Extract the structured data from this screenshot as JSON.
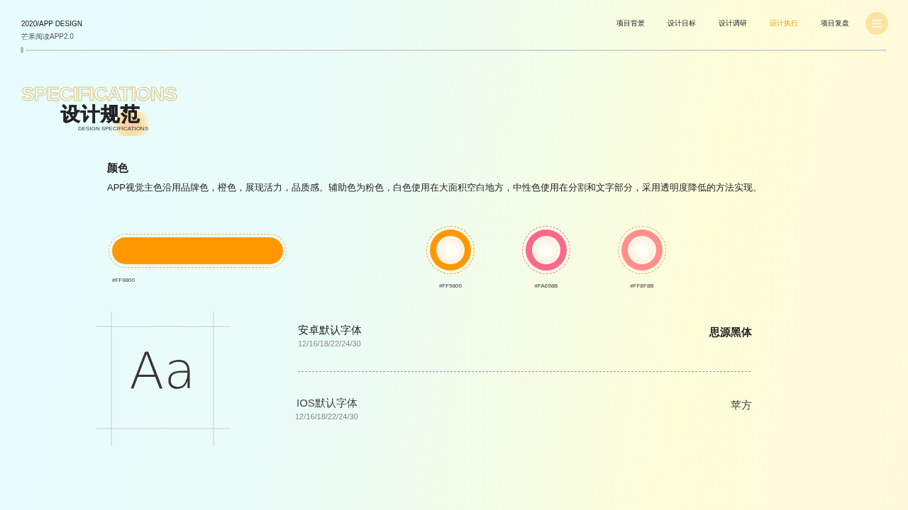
{
  "header": {
    "title": "2020/APP DESIGN",
    "subtitle": "芒果阅读APP2.0"
  },
  "nav": [
    {
      "label": "项目背景",
      "selected": false
    },
    {
      "label": "设计目标",
      "selected": false
    },
    {
      "label": "设计调研",
      "selected": false
    },
    {
      "label": "设计执行",
      "selected": true
    },
    {
      "label": "项目复盘",
      "selected": false
    }
  ],
  "section_heading": {
    "outline_text": "SPECIFICATIONS",
    "title": "设计规范",
    "subtitle": "DESIGN SPECIFICATIONS"
  },
  "colors": {
    "heading": "颜色",
    "description": "APP视觉主色沿用品牌色，橙色，展现活力，品质感。辅助色为粉色，白色使用在大面积空白地方，中性色使用在分割和文字部分，采用透明度降低的方法实现。",
    "swatches": [
      {
        "kind": "bar",
        "color": "#ff9800",
        "label": "#FF9800"
      },
      {
        "kind": "circle",
        "color": "#ff9800",
        "label": "#FF9800"
      },
      {
        "kind": "circle",
        "color": "#fa698b",
        "label": "#FA698B"
      },
      {
        "kind": "circle",
        "color": "#ff8f8b",
        "label": "#FF8F8B"
      }
    ]
  },
  "typography": {
    "sample": "Aa",
    "fonts": [
      {
        "platform": "安卓默认字体",
        "sizes": "12/16/18/22/24/30",
        "font": "思源黑体"
      },
      {
        "platform": "IOS默认字体",
        "sizes": "12/16/18/22/24/30",
        "font": "苹方"
      }
    ]
  }
}
